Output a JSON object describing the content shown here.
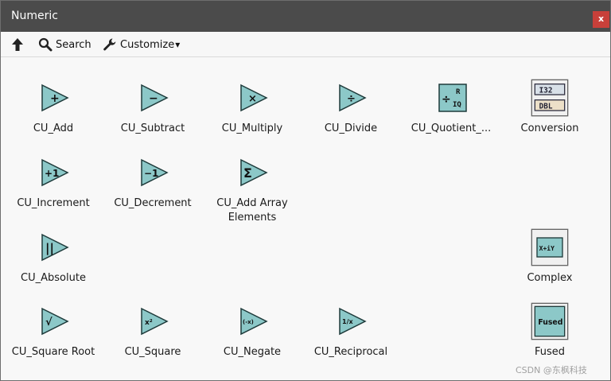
{
  "window": {
    "title": "Numeric",
    "close_glyph": "x"
  },
  "toolbar": {
    "up_icon": "up-arrow-icon",
    "search_label": "Search",
    "customize_label": "Customize",
    "customize_caret": "▾"
  },
  "palette": {
    "add": "CU_Add",
    "subtract": "CU_Subtract",
    "multiply": "CU_Multiply",
    "divide": "CU_Divide",
    "quotient": "CU_Quotient_...",
    "conversion": "Conversion",
    "increment": "CU_Increment",
    "decrement": "CU_Decrement",
    "add_array_line1": "CU_Add Array",
    "add_array_line2": "Elements",
    "absolute": "CU_Absolute",
    "complex": "Complex",
    "square_root": "CU_Square Root",
    "square": "CU_Square",
    "negate": "CU_Negate",
    "reciprocal": "CU_Reciprocal",
    "fused": "Fused"
  },
  "icon_glyphs": {
    "add": "+",
    "subtract": "−",
    "multiply": "×",
    "divide": "÷",
    "increment": "+1",
    "decrement": "−1",
    "add_array": "Σ",
    "absolute": "||",
    "square_root": "√",
    "square": "x²",
    "negate": "(-x)",
    "reciprocal": "1/x",
    "quotient_r": "R",
    "quotient_iq": "IQ",
    "conversion_top": "I32",
    "conversion_bottom": "DBL",
    "complex": "X+iY",
    "fused": "Fused"
  },
  "colors": {
    "titlebar": "#4b4b4b",
    "close_button": "#c8403a",
    "icon_fill": "#8cc8c8",
    "icon_stroke": "#1e3a3a"
  },
  "watermark": "CSDN @东枫科技"
}
